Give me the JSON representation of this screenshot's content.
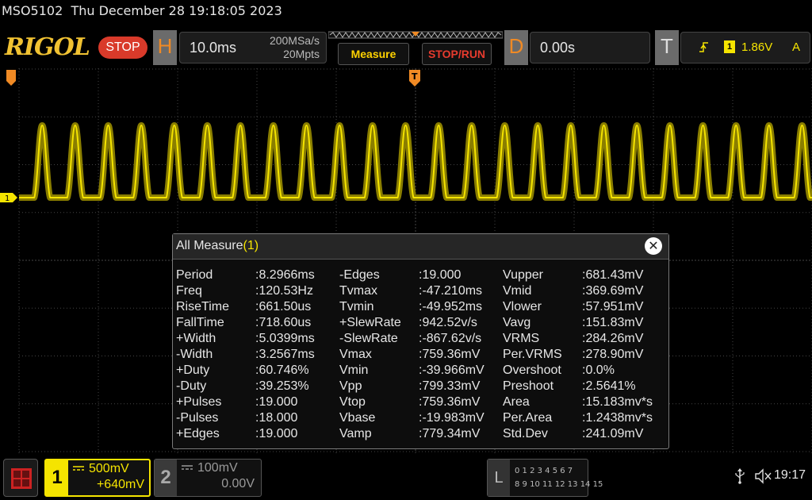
{
  "header": {
    "model": "MSO5102",
    "datetime": "Thu December 28 19:18:05 2023"
  },
  "toolbar": {
    "logo": "RIGOL",
    "run_state": "STOP",
    "horizontal": {
      "letter": "H",
      "timebase": "10.0ms",
      "sample_rate": "200MSa/s",
      "memory_depth": "20Mpts"
    },
    "measure_label": "Measure",
    "stoprun_label": "STOP/RUN",
    "delay": {
      "letter": "D",
      "value": "0.00s"
    },
    "trigger": {
      "letter": "T",
      "channel": "1",
      "level": "1.86V",
      "mode": "A"
    }
  },
  "markers": {
    "ch1_marker": "1",
    "trigger_pos": "T"
  },
  "measure": {
    "title": "All Measure",
    "channel": "(1)",
    "close_label": "✕",
    "columns": [
      [
        {
          "name": "Period",
          "value": ":8.2966ms"
        },
        {
          "name": "Freq",
          "value": ":120.53Hz"
        },
        {
          "name": "RiseTime",
          "value": ":661.50us"
        },
        {
          "name": "FallTime",
          "value": ":718.60us"
        },
        {
          "name": "+Width",
          "value": ":5.0399ms"
        },
        {
          "name": "-Width",
          "value": ":3.2567ms"
        },
        {
          "name": "+Duty",
          "value": ":60.746%"
        },
        {
          "name": "-Duty",
          "value": ":39.253%"
        },
        {
          "name": "+Pulses",
          "value": ":19.000"
        },
        {
          "name": "-Pulses",
          "value": ":18.000"
        },
        {
          "name": "+Edges",
          "value": ":19.000"
        }
      ],
      [
        {
          "name": "-Edges",
          "value": ":19.000"
        },
        {
          "name": "Tvmax",
          "value": ":-47.210ms"
        },
        {
          "name": "Tvmin",
          "value": ":-49.952ms"
        },
        {
          "name": "+SlewRate",
          "value": ":942.52v/s"
        },
        {
          "name": "-SlewRate",
          "value": ":-867.62v/s"
        },
        {
          "name": "Vmax",
          "value": ":759.36mV"
        },
        {
          "name": "Vmin",
          "value": ":-39.966mV"
        },
        {
          "name": "Vpp",
          "value": ":799.33mV"
        },
        {
          "name": "Vtop",
          "value": ":759.36mV"
        },
        {
          "name": "Vbase",
          "value": ":-19.983mV"
        },
        {
          "name": "Vamp",
          "value": ":779.34mV"
        }
      ],
      [
        {
          "name": "Vupper",
          "value": ":681.43mV"
        },
        {
          "name": "Vmid",
          "value": ":369.69mV"
        },
        {
          "name": "Vlower",
          "value": ":57.951mV"
        },
        {
          "name": "Vavg",
          "value": ":151.83mV"
        },
        {
          "name": "VRMS",
          "value": ":284.26mV"
        },
        {
          "name": "Per.VRMS",
          "value": ":278.90mV"
        },
        {
          "name": "Overshoot",
          "value": ":0.0%"
        },
        {
          "name": "Preshoot",
          "value": ":2.5641%"
        },
        {
          "name": "Area",
          "value": ":15.183mv*s"
        },
        {
          "name": "Per.Area",
          "value": ":1.2438mv*s"
        },
        {
          "name": "Std.Dev",
          "value": ":241.09mV"
        }
      ]
    ]
  },
  "channels": {
    "ch1": {
      "num": "1",
      "scale": "500mV",
      "offset": "+640mV",
      "color": "#f5e400"
    },
    "ch2": {
      "num": "2",
      "scale": "100mV",
      "offset": "0.00V",
      "color": "#9a9a9a"
    }
  },
  "la": {
    "letter": "L",
    "line1": "0 1 2 3   4 5 6 7",
    "line2": "8  9 10 11  12 13 14 15"
  },
  "status": {
    "clock": "19:17"
  },
  "waveform": {
    "pulse_count": 24,
    "color": "#f5e400"
  }
}
